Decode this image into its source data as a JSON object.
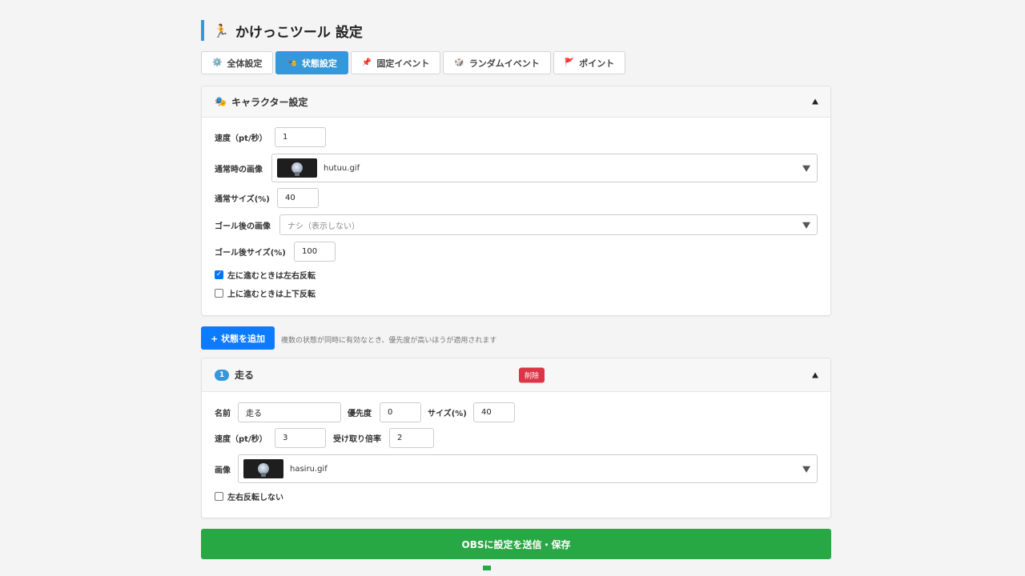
{
  "title": {
    "icon": "🏃",
    "text": "かけっこツール 設定"
  },
  "tabs": [
    {
      "icon": "⚙️",
      "label": "全体設定",
      "active": false
    },
    {
      "icon": "🎭",
      "label": "状態設定",
      "active": true
    },
    {
      "icon": "📌",
      "label": "固定イベント",
      "active": false
    },
    {
      "icon": "🎲",
      "label": "ランダムイベント",
      "active": false
    },
    {
      "icon": "🚩",
      "label": "ポイント",
      "active": false
    }
  ],
  "character": {
    "icon": "🎭",
    "heading": "キャラクター設定",
    "speed_label": "速度（pt/秒）",
    "speed_value": "1",
    "normal_image_label": "通常時の画像",
    "normal_image_file": "hutuu.gif",
    "normal_size_label": "通常サイズ(%)",
    "normal_size_value": "40",
    "goal_image_label": "ゴール後の画像",
    "goal_image_placeholder": "ナシ（表示しない）",
    "goal_size_label": "ゴール後サイズ(%)",
    "goal_size_value": "100",
    "flip_left_label": "左に進むときは左右反転",
    "flip_left_checked": true,
    "flip_up_label": "上に進むときは上下反転",
    "flip_up_checked": false
  },
  "add_state": {
    "button_label": "+ 状態を追加",
    "hint": "複数の状態が同時に有効なとき、優先度が高いほうが適用されます"
  },
  "state_1": {
    "index": "1",
    "name_heading": "走る",
    "delete_label": "削除",
    "name_label": "名前",
    "name_value": "走る",
    "priority_label": "優先度",
    "priority_value": "0",
    "size_label": "サイズ(%)",
    "size_value": "40",
    "speed_label": "速度（pt/秒）",
    "speed_value": "3",
    "receive_label": "受け取り倍率",
    "receive_value": "2",
    "image_label": "画像",
    "image_file": "hasiru.gif",
    "no_flip_label": "左右反転しない",
    "no_flip_checked": false
  },
  "save_button": "OBSに設定を送信・保存",
  "colors": {
    "accent": "#3498db",
    "add": "#0d7bff",
    "delete": "#dc3545",
    "save": "#28a745"
  }
}
